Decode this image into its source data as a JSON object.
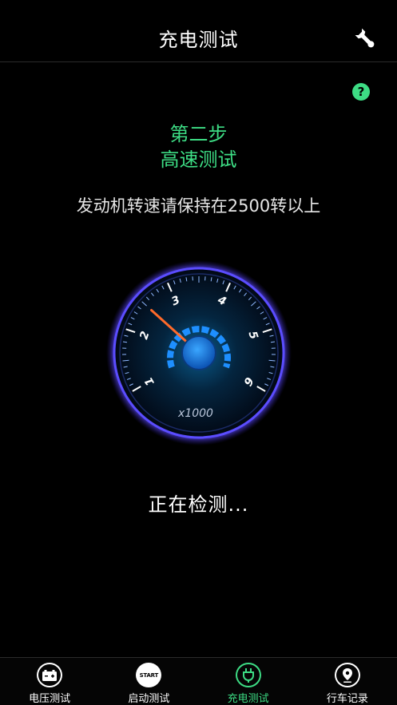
{
  "header": {
    "title": "充电测试"
  },
  "step": {
    "title": "第二步",
    "subtitle": "高速测试"
  },
  "instruction": "发动机转速请保持在2500转以上",
  "gauge": {
    "unit_label": "x1000",
    "ticks": [
      "1",
      "2",
      "3",
      "4",
      "5",
      "6"
    ],
    "value": 2.5
  },
  "status": "正在检测...",
  "nav": {
    "items": [
      {
        "label": "电压测试",
        "icon": "battery-icon",
        "active": false
      },
      {
        "label": "启动测试",
        "icon": "start-icon",
        "icon_text": "START",
        "active": false
      },
      {
        "label": "充电测试",
        "icon": "plug-icon",
        "active": true
      },
      {
        "label": "行车记录",
        "icon": "location-pin-icon",
        "active": false
      }
    ]
  },
  "colors": {
    "accent": "#3ddc84",
    "gauge_blue": "#1e8fff",
    "needle": "#ff6a2a"
  }
}
